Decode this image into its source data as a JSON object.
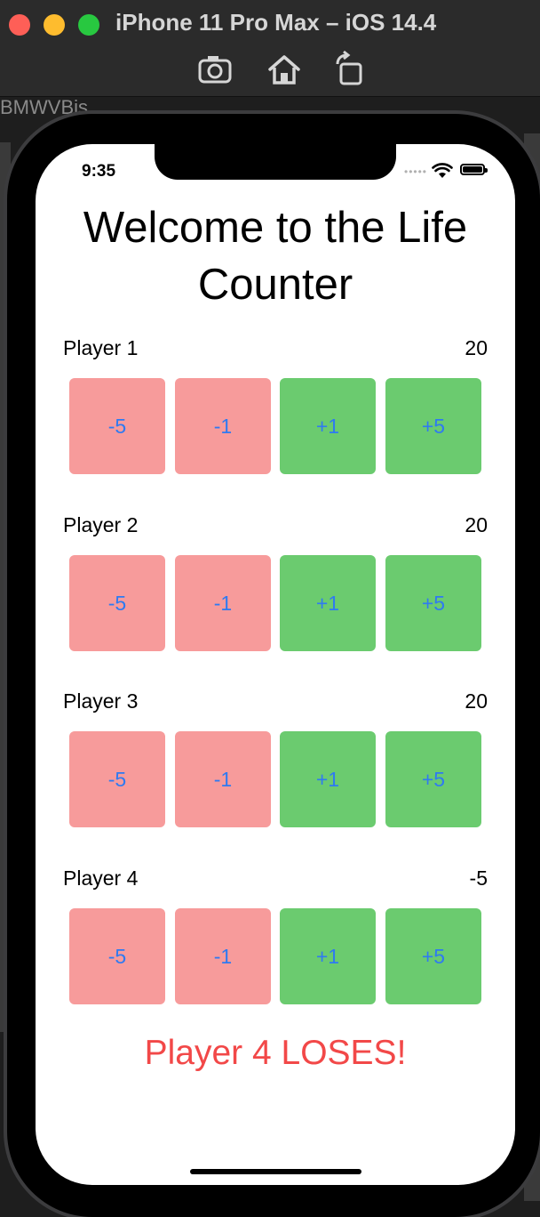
{
  "window": {
    "title": "iPhone 11 Pro Max – iOS 14.4",
    "toolbar": {
      "screenshot_icon": "camera-icon",
      "home_icon": "home-icon",
      "rotate_icon": "rotate-icon"
    },
    "background_text": "BMWVBis"
  },
  "status_bar": {
    "time": "9:35",
    "signal": "•••••"
  },
  "app": {
    "title": "Welcome to the Life Counter",
    "players": [
      {
        "name": "Player 1",
        "life": "20"
      },
      {
        "name": "Player 2",
        "life": "20"
      },
      {
        "name": "Player 3",
        "life": "20"
      },
      {
        "name": "Player 4",
        "life": "-5"
      }
    ],
    "buttons": [
      "-5",
      "-1",
      "+1",
      "+5"
    ],
    "status": "Player 4 LOSES!"
  },
  "colors": {
    "decrement": "#f79b9b",
    "increment": "#6bcb6f",
    "button_text": "#2f7af1",
    "lose_text": "#f24848"
  }
}
